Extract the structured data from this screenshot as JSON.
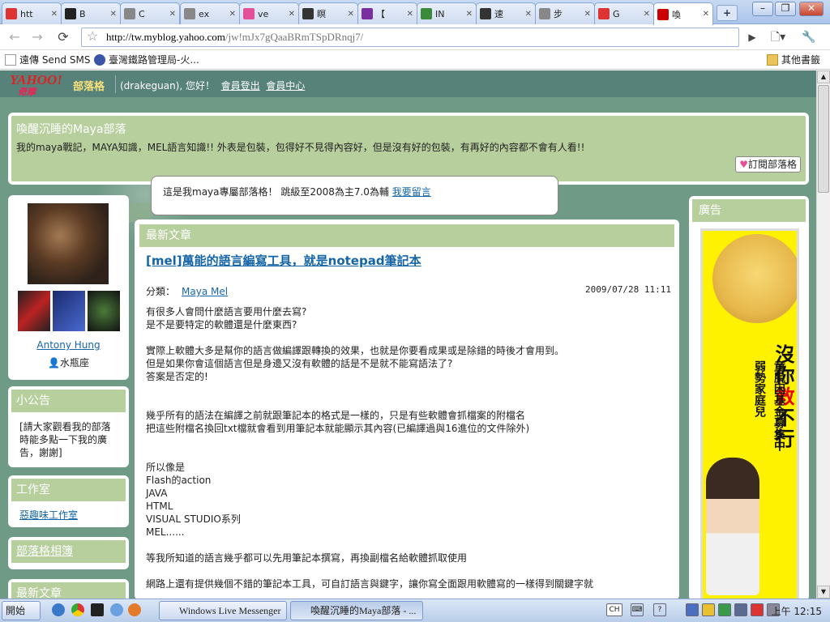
{
  "browser": {
    "tabs": [
      {
        "label": "htt",
        "fav_color": "#d33"
      },
      {
        "label": "B",
        "fav_color": "#222"
      },
      {
        "label": "C",
        "fav_color": "#888"
      },
      {
        "label": "ex",
        "fav_color": "#888"
      },
      {
        "label": "ve",
        "fav_color": "#e3519a"
      },
      {
        "label": "瞑",
        "fav_color": "#333"
      },
      {
        "label": "【",
        "fav_color": "#7a2f9e"
      },
      {
        "label": "IN",
        "fav_color": "#3b8a3b"
      },
      {
        "label": "速",
        "fav_color": "#333"
      },
      {
        "label": "步",
        "fav_color": "#888"
      },
      {
        "label": "G",
        "fav_color": "#d33"
      },
      {
        "label": "喚",
        "fav_color": "#c00"
      }
    ],
    "url_host": "http://tw.myblog.yahoo.com",
    "url_path": "/jw!mJx7gQaaBRmTSpDRnqj7/",
    "bookmarks": {
      "items": [
        "遠傳 Send SMS",
        "臺灣鐵路管理局-火..."
      ],
      "other": "其他書籤"
    }
  },
  "yahoo_bar": {
    "logo": "YAHOO!",
    "logo_sub": "奇摩",
    "blog_label": "部落格",
    "greeting": "(drakeguan), 您好！",
    "logout": "會員登出",
    "member_center": "會員中心"
  },
  "header": {
    "title": "喚醒沉睡的Maya部落",
    "description": "我的maya戰記，MAYA知識，MEL語言知識!! 外表是包裝，包得好不見得內容好，但是沒有好的包裝，有再好的內容都不會有人看!!",
    "subscribe": "訂閱部落格"
  },
  "bubble": {
    "text": "這是我maya專屬部落格！ 跳級至2008為主7.0為輔",
    "link": "我要留言"
  },
  "profile": {
    "name": "Antony Hung",
    "sign": "水瓶座"
  },
  "sidebar": {
    "notice_title": "小公告",
    "notice_text": "[請大家觀看我的部落時能多點一下我的廣告，謝謝]",
    "studio_title": "工作室",
    "studio_link": "惡趣味工作室",
    "album_title": "部落格相簿",
    "recent_title": "最新文章"
  },
  "main": {
    "section_title": "最新文章",
    "post_title": "[mel]萬能的語言編寫工具，就是notepad筆記本",
    "category_label": "分類：",
    "category": "Maya Mel",
    "date": "2009/07/28 11:11",
    "paragraphs": [
      "有很多人會問什麼語言要用什麼去寫?\n是不是要特定的軟體還是什麼東西?",
      "實際上軟體大多是幫你的語言做編譯跟轉換的效果，也就是你要看成果或是除錯的時後才會用到。\n但是如果你會這個語言但是身邊又沒有軟體的話是不是就不能寫語法了?\n答案是否定的!",
      "\n幾乎所有的語法在編譯之前就跟筆記本的格式是一樣的，只是有些軟體會抓檔案的附檔名\n把這些附檔名換回txt檔就會看到用筆記本就能顯示其內容(已編譯過與16進位的文件除外)",
      "\n所以像是\nFlash的action\nJAVA\nHTML\nVISUAL STUDIO系列\nMEL......",
      "等我所知道的語言幾乎都可以先用筆記本撰寫，再換副檔名給軟體抓取使用",
      "網路上還有提供幾個不錯的筆記本工具，可自訂語言與鍵字，讓你寫全面跟用軟體寫的一樣得到關鍵字就"
    ]
  },
  "ad": {
    "title": "廣告",
    "headline_a": "沒你",
    "headline_red": "救",
    "headline_b": "不行",
    "sub1": "弱勢家庭兒",
    "sub2": "童脫困基金募集中"
  },
  "taskbar": {
    "start": "開始",
    "tasks": [
      "Windows Live Messenger",
      "喚醒沉睡的Maya部落 - ..."
    ],
    "lang": "CH",
    "clock": "上午 12:15"
  }
}
